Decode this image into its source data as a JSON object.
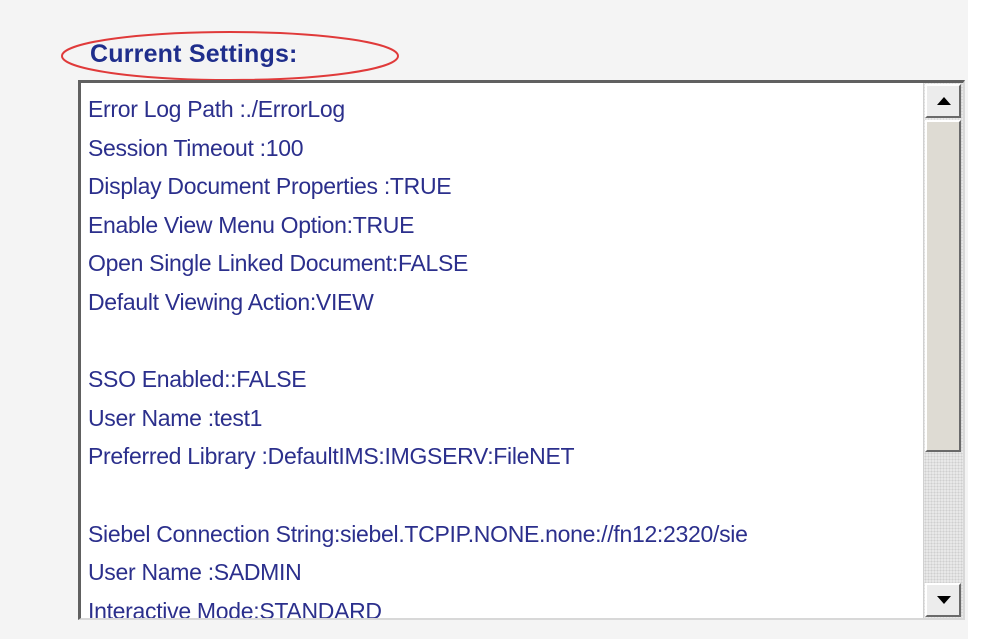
{
  "heading": "Current Settings:",
  "settings_lines": [
    "Error Log Path :./ErrorLog",
    "Session Timeout :100",
    "Display Document Properties :TRUE",
    "Enable View Menu Option:TRUE",
    "Open Single Linked Document:FALSE",
    "Default Viewing Action:VIEW",
    "",
    "SSO Enabled::FALSE",
    "User Name :test1",
    "Preferred Library :DefaultIMS:IMGSERV:FileNET",
    "",
    "Siebel Connection String:siebel.TCPIP.NONE.none://fn12:2320/sie",
    "User Name :SADMIN",
    "Interactive Mode:STANDARD"
  ],
  "scrollbar": {
    "up_icon": "arrow-up-icon",
    "down_icon": "arrow-down-icon",
    "position": 0.0
  },
  "colors": {
    "heading_text": "#1f2e8c",
    "annotation_ellipse": "#e03a3a",
    "setting_text": "#2b2f8c"
  }
}
